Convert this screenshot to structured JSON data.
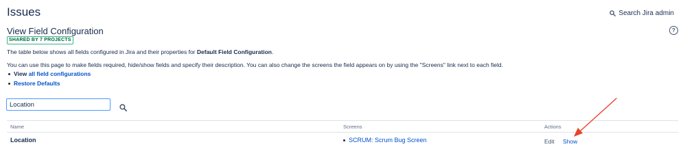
{
  "header": {
    "title": "Issues",
    "search_label": "Search Jira admin"
  },
  "section": {
    "title": "View Field Configuration",
    "shared_badge": "SHARED BY 7 PROJECTS",
    "help_icon_glyph": "?"
  },
  "description": {
    "line1_prefix": "The table below shows all fields configured in Jira and their properties for ",
    "line1_bold": "Default Field Configuration",
    "line1_suffix": ".",
    "line2": "You can use this page to make fields required, hide/show fields and specify their description. You can also change the screens the field appears on by using the \"Screens\" link next to each field."
  },
  "links": {
    "view_prefix": "View ",
    "view_rest": "all field configurations",
    "restore": "Restore Defaults"
  },
  "filter": {
    "value": "Location"
  },
  "table": {
    "headers": {
      "name": "Name",
      "screens": "Screens",
      "actions": "Actions"
    },
    "rows": [
      {
        "name": "Location",
        "screen": "SCRUM: Scrum Bug Screen",
        "action_edit": "Edit",
        "action_show": "Show"
      }
    ]
  },
  "colors": {
    "link": "#0052cc",
    "text": "#172b4d",
    "annotation_arrow": "#e8432a",
    "lozenge_border": "#36b37e"
  },
  "icons": {
    "admin_search": "search-icon",
    "filter_search": "search-icon",
    "help": "help-icon",
    "annotation": "arrow-annotation"
  }
}
